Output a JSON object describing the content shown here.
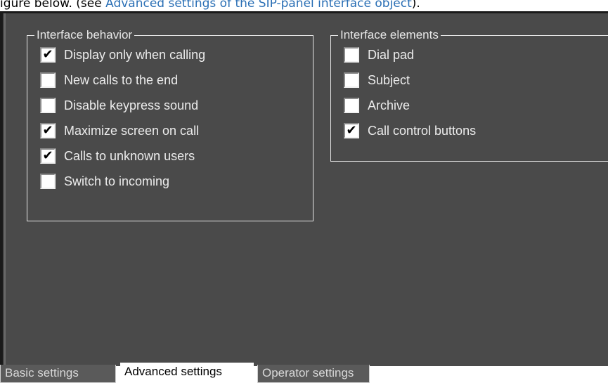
{
  "caption": {
    "prefix": "igure below. (see ",
    "link": "Advanced settings of the SIP-panel interface object",
    "suffix": ")."
  },
  "interface_behavior": {
    "title": "Interface behavior",
    "items": [
      {
        "label": "Display only when calling",
        "checked": true
      },
      {
        "label": "New calls to the end",
        "checked": false
      },
      {
        "label": "Disable keypress sound",
        "checked": false
      },
      {
        "label": "Maximize screen on call",
        "checked": true
      },
      {
        "label": "Calls to unknown users",
        "checked": true
      },
      {
        "label": "Switch to incoming",
        "checked": false
      }
    ]
  },
  "interface_elements": {
    "title": "Interface elements",
    "items": [
      {
        "label": "Dial pad",
        "checked": false
      },
      {
        "label": "Subject",
        "checked": false
      },
      {
        "label": "Archive",
        "checked": false
      },
      {
        "label": "Call control buttons",
        "checked": true
      }
    ]
  },
  "tabs": {
    "basic": "Basic settings",
    "advanced": "Advanced settings",
    "operator": "Operator settings",
    "active": "advanced"
  },
  "check_glyph": "✔"
}
